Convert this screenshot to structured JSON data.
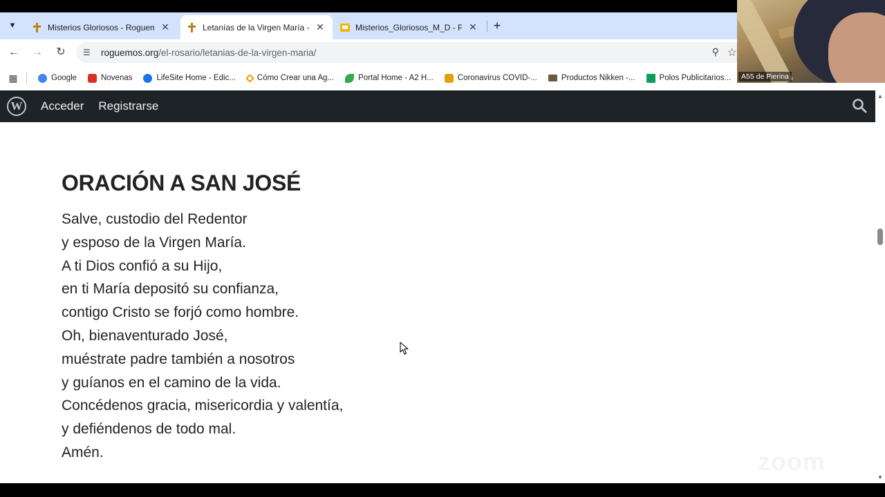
{
  "tabs": [
    {
      "title": "Misterios Gloriosos - Roguemos",
      "favicon": "rosary-icon",
      "active": false
    },
    {
      "title": "Letanías de la Virgen María - Roguemos",
      "favicon": "rosary-icon",
      "active": true
    },
    {
      "title": "Misterios_Gloriosos_M_D - Presentaciones",
      "favicon": "slides-icon",
      "active": false
    }
  ],
  "toolbar": {
    "url_host": "roguemos.org",
    "url_path": "/el-rosario/letanias-de-la-virgen-maria/"
  },
  "bookmarks": [
    {
      "label": "Google",
      "color": "#4285f4"
    },
    {
      "label": "Novenas",
      "color": "#d93025"
    },
    {
      "label": "LifeSite Home - Edic...",
      "color": "#1a73e8"
    },
    {
      "label": "Cómo Crear una Ag...",
      "color": "#f29900"
    },
    {
      "label": "Portal Home - A2 H...",
      "color": "#34a853"
    },
    {
      "label": "Coronavirus COVID-...",
      "color": "#e3a008"
    },
    {
      "label": "Productos Nikken -...",
      "color": "#6b5b3e"
    },
    {
      "label": "Polos Publicitarios...",
      "color": "#0f9d58"
    }
  ],
  "video": {
    "label": "A55 de Pierina"
  },
  "wp_bar": {
    "login": "Acceder",
    "register": "Registrarse"
  },
  "prayer": {
    "title": "ORACIÓN A SAN JOSÉ",
    "lines": [
      "Salve, custodio del Redentor",
      "y esposo de la Virgen María.",
      "A ti Dios confió a su Hijo,",
      "en ti María depositó su confianza,",
      "contigo Cristo se forjó como hombre.",
      "Oh, bienaventurado José,",
      "muéstrate padre también a nosotros",
      "y guíanos en el camino de la vida.",
      "Concédenos gracia, misericordia y valentía,",
      "y defiéndenos de todo mal.",
      "Amén."
    ]
  },
  "watermark": "zoom"
}
